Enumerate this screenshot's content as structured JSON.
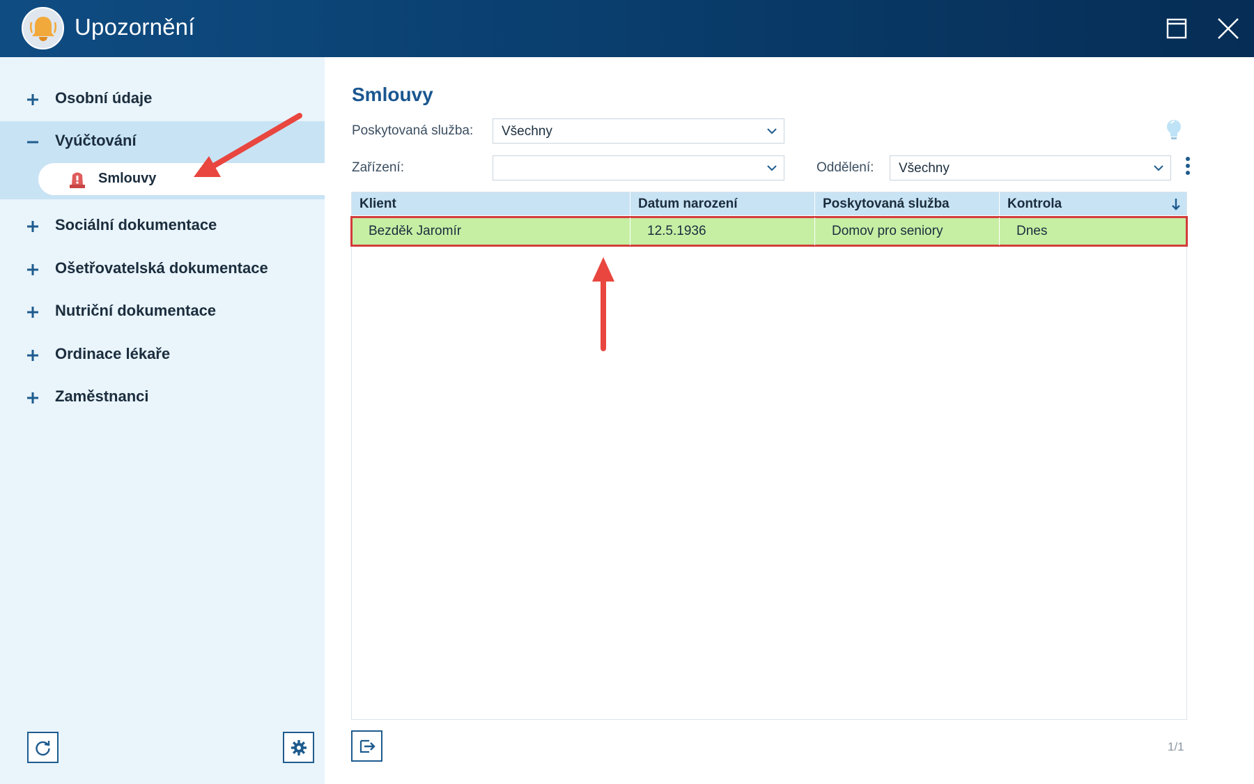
{
  "window": {
    "title": "Upozornění",
    "logo_icon": "bell-icon",
    "maximize_icon": "maximize-icon",
    "close_icon": "close-icon"
  },
  "sidebar": {
    "items": [
      {
        "label": "Osobní údaje",
        "state": "collapsed"
      },
      {
        "label": "Vyúčtování",
        "state": "expanded"
      },
      {
        "label": "Sociální dokumentace",
        "state": "collapsed"
      },
      {
        "label": "Ošetřovatelská dokumentace",
        "state": "collapsed"
      },
      {
        "label": "Nutriční dokumentace",
        "state": "collapsed"
      },
      {
        "label": "Ordinace lékaře",
        "state": "collapsed"
      },
      {
        "label": "Zaměstnanci",
        "state": "collapsed"
      }
    ],
    "active_subitem": {
      "label": "Smlouvy",
      "icon": "alarm-light-icon"
    },
    "refresh_icon": "refresh-icon",
    "settings_icon": "gear-icon"
  },
  "main": {
    "title": "Smlouvy",
    "filters": {
      "service_label": "Poskytovaná služba:",
      "service_value": "Všechny",
      "facility_label": "Zařízení:",
      "facility_value": "",
      "department_label": "Oddělení:",
      "department_value": "Všechny"
    },
    "table": {
      "columns": [
        "Klient",
        "Datum narození",
        "Poskytovaná služba",
        "Kontrola"
      ],
      "rows": [
        [
          "Bezděk Jaromír",
          "12.5.1936",
          "Domov pro seniory",
          "Dnes"
        ]
      ]
    },
    "pager": "1/1"
  },
  "colors": {
    "titlebar": "#0a3f6f",
    "sidebar_bg": "#e9f4fb",
    "selected": "#c8e3f4",
    "row_highlight": "#c6efa4",
    "annotation": "#e8463f",
    "accent": "#1a5690"
  }
}
